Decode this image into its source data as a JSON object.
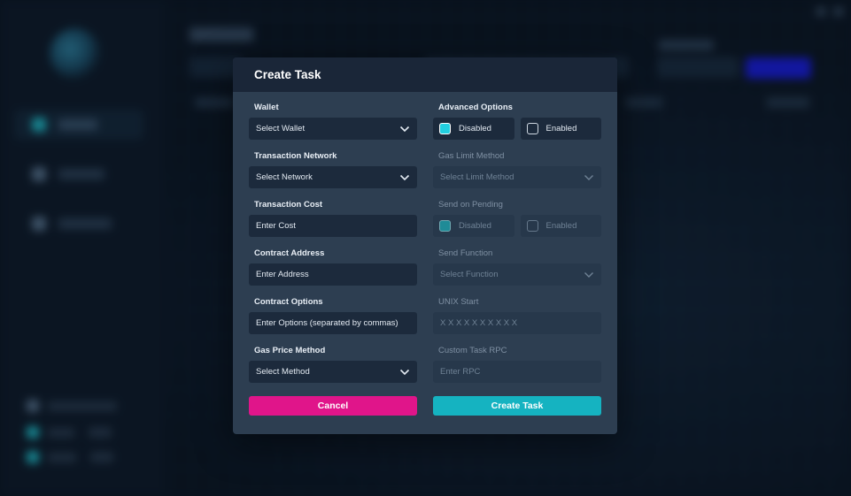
{
  "colors": {
    "cancel": "#e0158a",
    "create": "#15b3c1",
    "checkbox_on": "#22cfe0",
    "modal_bg": "#2d3e51",
    "input_bg": "#1c2a3c"
  },
  "modal": {
    "title": "Create Task",
    "left_fields": [
      {
        "label": "Wallet",
        "type": "select",
        "value": "Select Wallet"
      },
      {
        "label": "Transaction Network",
        "type": "select",
        "value": "Select Network"
      },
      {
        "label": "Transaction Cost",
        "type": "input",
        "value": "Enter Cost"
      },
      {
        "label": "Contract Address",
        "type": "input",
        "value": "Enter Address"
      },
      {
        "label": "Contract Options",
        "type": "input",
        "value": "Enter Options (separated by commas)"
      },
      {
        "label": "Gas Price Method",
        "type": "select",
        "value": "Select Method"
      }
    ],
    "advanced_options": {
      "label": "Advanced Options",
      "disabled_label": "Disabled",
      "enabled_label": "Enabled",
      "selected": "Disabled"
    },
    "gas_limit": {
      "label": "Gas Limit Method",
      "value": "Select Limit Method"
    },
    "send_on_pending": {
      "label": "Send on Pending",
      "disabled_label": "Disabled",
      "enabled_label": "Enabled",
      "selected": "Disabled"
    },
    "send_function": {
      "label": "Send Function",
      "value": "Select Function"
    },
    "unix_start": {
      "label": "UNIX Start",
      "value": "X X X X X X X X X X"
    },
    "custom_rpc": {
      "label": "Custom Task RPC",
      "value": "Enter RPC"
    },
    "cancel_label": "Cancel",
    "create_label": "Create Task"
  }
}
